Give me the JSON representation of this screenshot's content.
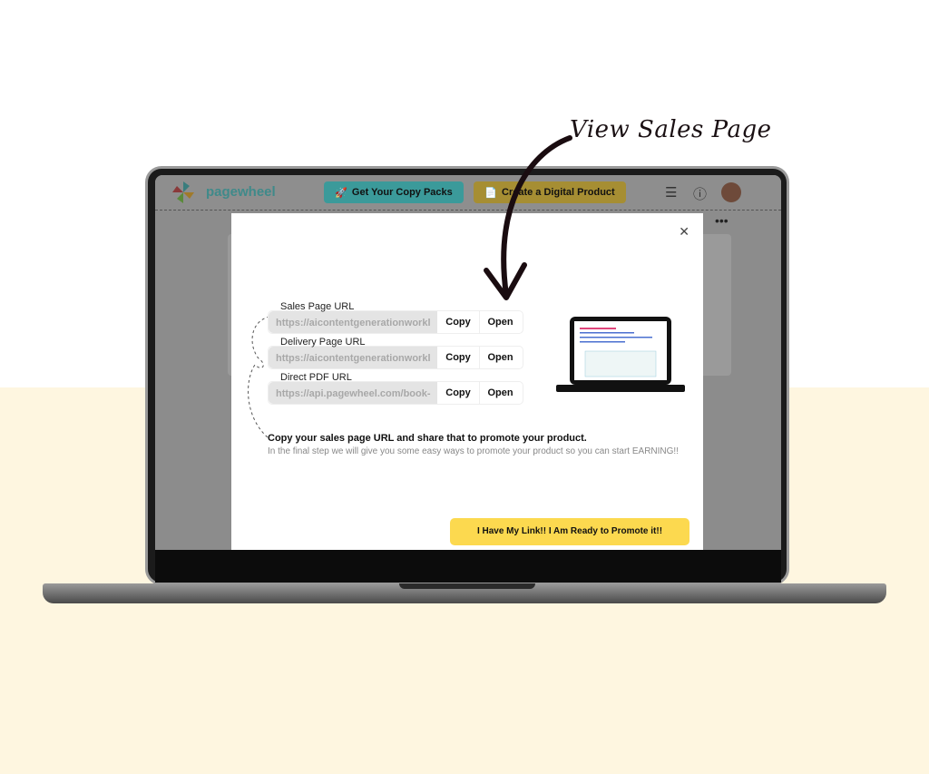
{
  "callout": {
    "text": "View Sales Page"
  },
  "app": {
    "brand": "pagewheel",
    "copy_packs_label": "Get Your Copy Packs",
    "create_product_label": "Create a Digital Product",
    "icons": [
      "list-icon",
      "help-icon",
      "avatar"
    ]
  },
  "modal": {
    "rows": [
      {
        "label": "Sales Page URL",
        "url": "https://aicontentgenerationworkl",
        "copy": "Copy",
        "open": "Open"
      },
      {
        "label": "Delivery Page URL",
        "url": "https://aicontentgenerationworkl",
        "copy": "Copy",
        "open": "Open"
      },
      {
        "label": "Direct PDF URL",
        "url": "https://api.pagewheel.com/book-",
        "copy": "Copy",
        "open": "Open"
      }
    ],
    "message": "Copy your sales page URL and share that to promote your product.",
    "submessage": "In the final step we will give you some easy ways to promote your product so you can start EARNING!!",
    "cta": "I Have My Link!! I Am Ready to Promote it!!"
  },
  "colors": {
    "teal": "#3b9a9a",
    "gold": "#fcd94f",
    "cream": "#fef6e0"
  }
}
